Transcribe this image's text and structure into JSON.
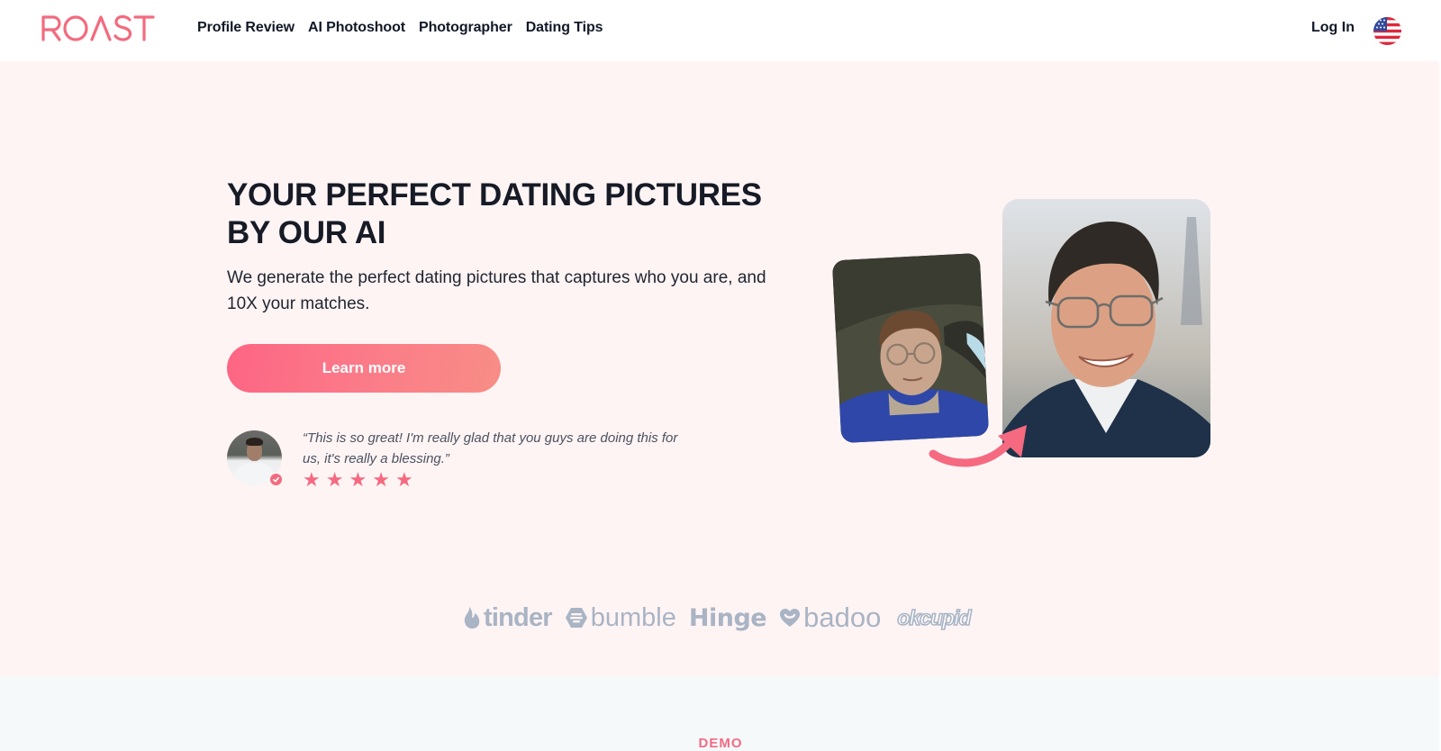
{
  "header": {
    "logo_text": "ROAST",
    "nav": [
      {
        "label": "Profile Review"
      },
      {
        "label": "AI Photoshoot"
      },
      {
        "label": "Photographer"
      },
      {
        "label": "Dating Tips"
      }
    ],
    "login_label": "Log In",
    "language_flag": "us-flag-icon"
  },
  "hero": {
    "title": "YOUR PERFECT DATING PICTURES BY OUR AI",
    "subtitle": "We generate the perfect dating pictures that captures who you are, and 10X your matches.",
    "cta_label": "Learn more",
    "testimonial": {
      "quote": "“This is so great! I'm really glad that you guys are doing this for us, it's really a blessing.”",
      "rating": 5,
      "stars": [
        "★",
        "★",
        "★",
        "★",
        "★"
      ],
      "verified": true
    },
    "images": {
      "before_alt": "Before: casual selfie in a car",
      "after_alt": "After: AI-generated professional portrait"
    }
  },
  "brands": [
    {
      "name": "tinder",
      "icon": "flame-icon"
    },
    {
      "name": "bumble",
      "icon": "bumble-hexagon-icon"
    },
    {
      "name": "Hinge",
      "icon": ""
    },
    {
      "name": "badoo",
      "icon": "heart-icon"
    },
    {
      "name": "okcupid",
      "icon": ""
    }
  ],
  "demo": {
    "label": "DEMO"
  },
  "colors": {
    "brand": "#f26b7e",
    "hero_bg": "#fff4f4",
    "demo_bg": "#f5f9fa",
    "brand_logos": "#a9b4c4",
    "text_dark": "#161b26"
  }
}
